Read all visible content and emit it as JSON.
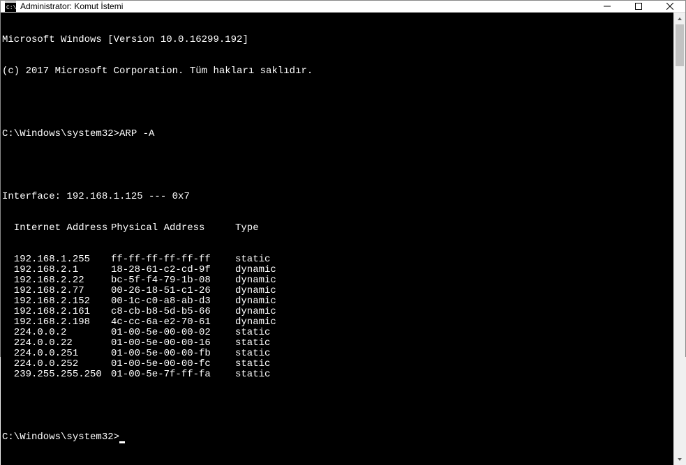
{
  "window": {
    "title": "Administrator: Komut İstemi"
  },
  "banner": {
    "version": "Microsoft Windows [Version 10.0.16299.192]",
    "copyright": "(c) 2017 Microsoft Corporation. Tüm hakları saklıdır."
  },
  "prompt1": {
    "path": "C:\\Windows\\system32>",
    "cmd": "ARP -A"
  },
  "interface_line": "Interface: 192.168.1.125 --- 0x7",
  "headers": {
    "ip": "  Internet Address",
    "mac": "Physical Address",
    "type": "Type"
  },
  "rows": [
    {
      "ip": "  192.168.1.255",
      "mac": "ff-ff-ff-ff-ff-ff",
      "type": "static"
    },
    {
      "ip": "  192.168.2.1",
      "mac": "18-28-61-c2-cd-9f",
      "type": "dynamic"
    },
    {
      "ip": "  192.168.2.22",
      "mac": "bc-5f-f4-79-1b-08",
      "type": "dynamic"
    },
    {
      "ip": "  192.168.2.77",
      "mac": "00-26-18-51-c1-26",
      "type": "dynamic"
    },
    {
      "ip": "  192.168.2.152",
      "mac": "00-1c-c0-a8-ab-d3",
      "type": "dynamic"
    },
    {
      "ip": "  192.168.2.161",
      "mac": "c8-cb-b8-5d-b5-66",
      "type": "dynamic"
    },
    {
      "ip": "  192.168.2.198",
      "mac": "4c-cc-6a-e2-70-61",
      "type": "dynamic"
    },
    {
      "ip": "  224.0.0.2",
      "mac": "01-00-5e-00-00-02",
      "type": "static"
    },
    {
      "ip": "  224.0.0.22",
      "mac": "01-00-5e-00-00-16",
      "type": "static"
    },
    {
      "ip": "  224.0.0.251",
      "mac": "01-00-5e-00-00-fb",
      "type": "static"
    },
    {
      "ip": "  224.0.0.252",
      "mac": "01-00-5e-00-00-fc",
      "type": "static"
    },
    {
      "ip": "  239.255.255.250",
      "mac": "01-00-5e-7f-ff-fa",
      "type": "static"
    }
  ],
  "prompt2": {
    "path": "C:\\Windows\\system32>"
  }
}
